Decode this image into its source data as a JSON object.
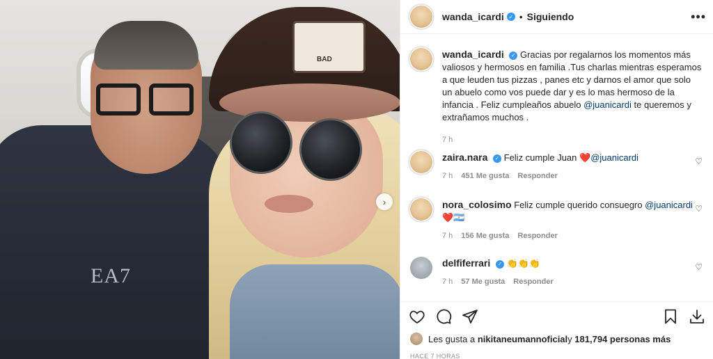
{
  "post": {
    "username": "wanda_icardi",
    "follow_status": "Siguiendo",
    "more_label": "•••",
    "next_arrow": "›",
    "photo_text": {
      "shirt_logo": "EA7",
      "cap_patch": "BAD"
    }
  },
  "caption": {
    "username": "wanda_icardi",
    "text": "Gracias por regalarnos los momentos más valiosos y hermosos en familia .Tus charlas mientras esperamos a que leuden tus pizzas , panes etc y darnos el amor que solo un abuelo como vos puede dar y es lo mas hermoso de la infancia . Feliz cumpleaños abuelo ",
    "mention": "@juanicardi",
    "text_after": " te queremos y extrañamos muchos .",
    "time": "7 h"
  },
  "comments": [
    {
      "username": "zaira.nara",
      "text": "Feliz cumple Juan ",
      "emoji": "❤️",
      "mention": "@juanicardi",
      "time": "7 h",
      "likes": "451 Me gusta",
      "reply": "Responder"
    },
    {
      "username": "nora_colosimo",
      "text": "Feliz cumple querido consuegro ",
      "mention": "@juanicardi",
      "emoji": "❤️🇦🇷",
      "time": "7 h",
      "likes": "156 Me gusta",
      "reply": "Responder"
    },
    {
      "username": "delfiferrari",
      "text": "",
      "emoji": "👏👏👏",
      "time": "7 h",
      "likes": "57 Me gusta",
      "reply": "Responder"
    }
  ],
  "likes": {
    "prefix": "Les gusta a ",
    "user": "nikitaneumannoficial",
    "middle": " y ",
    "count": "181,794 personas más"
  },
  "timestamp": "HACE 7 HORAS",
  "colors": {
    "verified": "#3897f0",
    "mention": "#00376b",
    "heart_red": "#ed4956"
  }
}
